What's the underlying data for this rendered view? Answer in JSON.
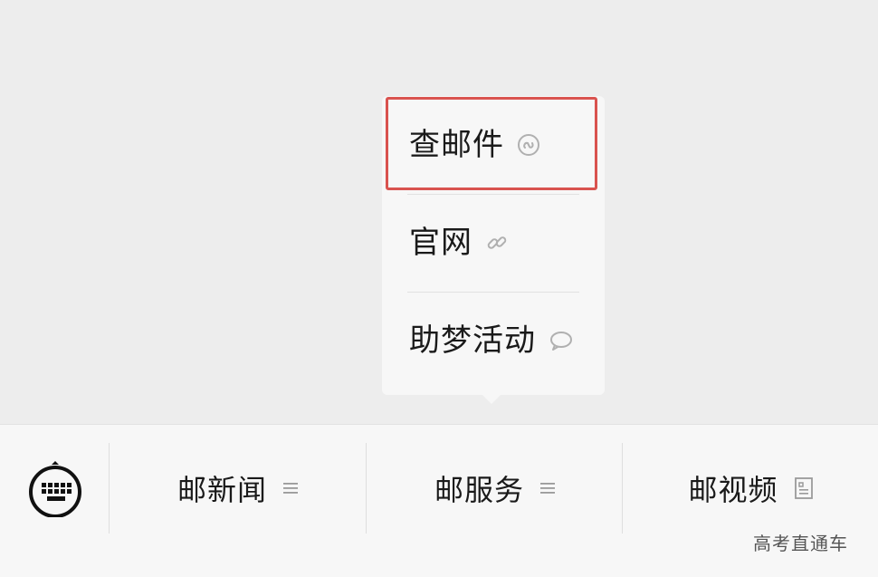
{
  "popup": {
    "items": [
      {
        "label": "查邮件",
        "icon": "mini-program-icon"
      },
      {
        "label": "官网",
        "icon": "link-icon"
      },
      {
        "label": "助梦活动",
        "icon": "chat-bubble-icon"
      }
    ],
    "highlight_color": "#d9534f"
  },
  "menubar": {
    "keyboard_icon": "keyboard-icon",
    "tabs": [
      {
        "label": "邮新闻",
        "icon": "menu-lines-icon"
      },
      {
        "label": "邮服务",
        "icon": "menu-lines-icon"
      },
      {
        "label": "邮视频",
        "icon": "article-icon"
      }
    ]
  },
  "watermark": "高考直通车"
}
